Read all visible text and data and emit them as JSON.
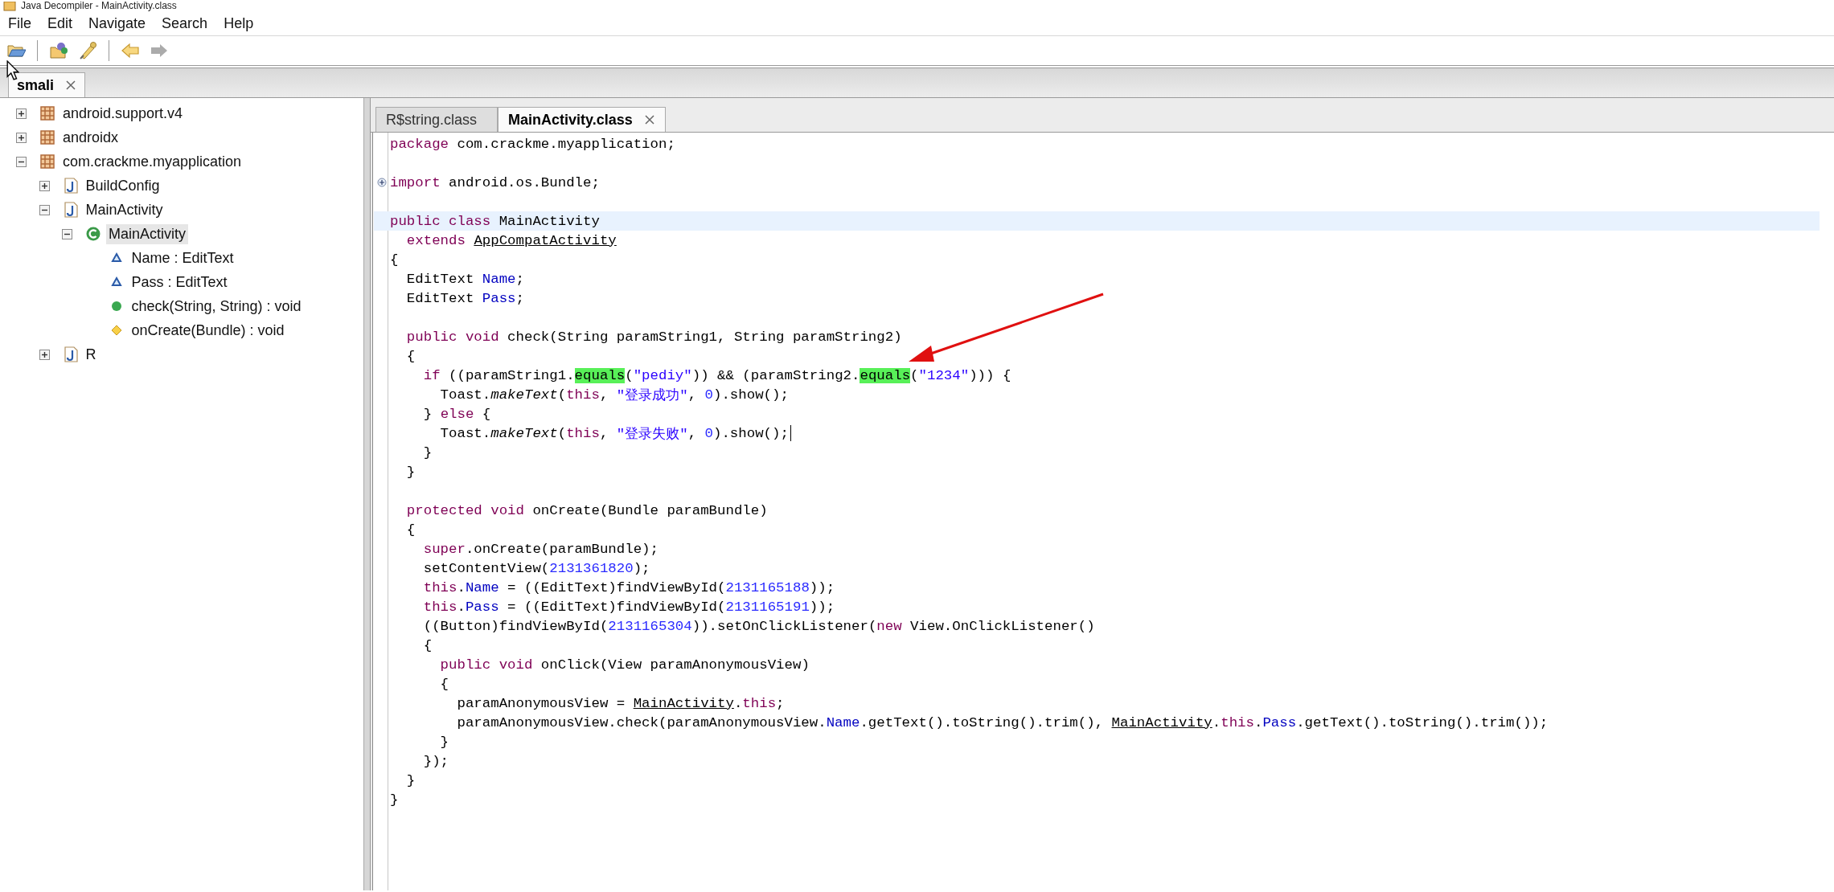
{
  "window": {
    "title": "Java Decompiler - MainActivity.class"
  },
  "menu": [
    "File",
    "Edit",
    "Navigate",
    "Search",
    "Help"
  ],
  "toolbar": [
    {
      "kind": "open",
      "disabled": false
    },
    {
      "kind": "separator"
    },
    {
      "kind": "open_type",
      "disabled": false
    },
    {
      "kind": "search",
      "disabled": false
    },
    {
      "kind": "separator"
    },
    {
      "kind": "back",
      "disabled": false
    },
    {
      "kind": "forward",
      "disabled": true
    }
  ],
  "file_tabs": [
    {
      "label": "smali",
      "selected": true
    }
  ],
  "tree": [
    {
      "label": "android.support.v4",
      "kind": "package",
      "expanded": false,
      "selected": false
    },
    {
      "label": "androidx",
      "kind": "package",
      "expanded": false,
      "selected": false
    },
    {
      "label": "com.crackme.myapplication",
      "kind": "package",
      "expanded": true,
      "selected": false,
      "children": [
        {
          "label": "BuildConfig",
          "kind": "class_file",
          "expanded": false,
          "selected": false
        },
        {
          "label": "MainActivity",
          "kind": "class_file",
          "expanded": true,
          "selected": false,
          "children": [
            {
              "label": "MainActivity",
              "kind": "class",
              "expanded": true,
              "selected": true,
              "children": [
                {
                  "label": "Name : EditText",
                  "kind": "field",
                  "selected": false
                },
                {
                  "label": "Pass : EditText",
                  "kind": "field",
                  "selected": false
                },
                {
                  "label": "check(String, String) : void",
                  "kind": "method_public",
                  "selected": false
                },
                {
                  "label": "onCreate(Bundle) : void",
                  "kind": "method_protected",
                  "selected": false
                }
              ]
            }
          ]
        },
        {
          "label": "R",
          "kind": "class_file",
          "expanded": false,
          "selected": false
        }
      ]
    }
  ],
  "editor_tabs": [
    {
      "label": "R$string.class",
      "selected": false
    },
    {
      "label": "MainActivity.class",
      "selected": true
    }
  ],
  "code": [
    {
      "kind": "code",
      "tokens": [
        {
          "kind": "keyword",
          "text": "package"
        },
        {
          "kind": "text",
          "text": " com.crackme.myapplication;"
        }
      ]
    },
    {
      "kind": "blank"
    },
    {
      "kind": "folded",
      "tokens": [
        {
          "kind": "keyword",
          "text": "import"
        },
        {
          "kind": "text",
          "text": " android.os.Bundle;"
        }
      ]
    },
    {
      "kind": "blank"
    },
    {
      "kind": "current",
      "tokens": [
        {
          "kind": "keyword",
          "text": "public class"
        },
        {
          "kind": "text",
          "text": " MainActivity"
        }
      ]
    },
    {
      "kind": "code",
      "tokens": [
        {
          "kind": "keyword",
          "text": "  extends "
        },
        {
          "kind": "link",
          "text": "AppCompatActivity"
        }
      ]
    },
    {
      "kind": "code",
      "tokens": [
        {
          "kind": "text",
          "text": "{"
        }
      ]
    },
    {
      "kind": "code",
      "tokens": [
        {
          "kind": "text",
          "text": "  EditText "
        },
        {
          "kind": "field",
          "text": "Name"
        },
        {
          "kind": "text",
          "text": ";"
        }
      ]
    },
    {
      "kind": "code",
      "tokens": [
        {
          "kind": "text",
          "text": "  EditText "
        },
        {
          "kind": "field",
          "text": "Pass"
        },
        {
          "kind": "text",
          "text": ";"
        }
      ]
    },
    {
      "kind": "blank"
    },
    {
      "kind": "code",
      "tokens": [
        {
          "kind": "keyword",
          "text": "  public void"
        },
        {
          "kind": "text",
          "text": " check(String paramString1, String paramString2)"
        }
      ]
    },
    {
      "kind": "code",
      "tokens": [
        {
          "kind": "text",
          "text": "  {"
        }
      ]
    },
    {
      "kind": "code",
      "tokens": [
        {
          "kind": "keyword",
          "text": "    if"
        },
        {
          "kind": "text",
          "text": " ((paramString1."
        },
        {
          "kind": "match",
          "text": "equals"
        },
        {
          "kind": "text",
          "text": "("
        },
        {
          "kind": "string",
          "text": "\"pediy\""
        },
        {
          "kind": "text",
          "text": ")) && (paramString2."
        },
        {
          "kind": "match",
          "text": "equals"
        },
        {
          "kind": "text",
          "text": "("
        },
        {
          "kind": "string",
          "text": "\"1234\""
        },
        {
          "kind": "text",
          "text": "))) {"
        }
      ]
    },
    {
      "kind": "code",
      "tokens": [
        {
          "kind": "text",
          "text": "      Toast."
        },
        {
          "kind": "static_call",
          "text": "makeText"
        },
        {
          "kind": "text",
          "text": "("
        },
        {
          "kind": "keyword",
          "text": "this"
        },
        {
          "kind": "text",
          "text": ", "
        },
        {
          "kind": "string",
          "text": "\"登录成功\""
        },
        {
          "kind": "text",
          "text": ", "
        },
        {
          "kind": "number",
          "text": "0"
        },
        {
          "kind": "text",
          "text": ").show();"
        }
      ]
    },
    {
      "kind": "code",
      "tokens": [
        {
          "kind": "text",
          "text": "    } "
        },
        {
          "kind": "keyword",
          "text": "else"
        },
        {
          "kind": "text",
          "text": " {"
        }
      ]
    },
    {
      "kind": "code",
      "tokens": [
        {
          "kind": "text",
          "text": "      Toast."
        },
        {
          "kind": "static_call",
          "text": "makeText"
        },
        {
          "kind": "text",
          "text": "("
        },
        {
          "kind": "keyword",
          "text": "this"
        },
        {
          "kind": "text",
          "text": ", "
        },
        {
          "kind": "string",
          "text": "\"登录失败\""
        },
        {
          "kind": "text",
          "text": ", "
        },
        {
          "kind": "number",
          "text": "0"
        },
        {
          "kind": "text",
          "text": ").show();"
        },
        {
          "kind": "caret"
        }
      ]
    },
    {
      "kind": "code",
      "tokens": [
        {
          "kind": "text",
          "text": "    }"
        }
      ]
    },
    {
      "kind": "code",
      "tokens": [
        {
          "kind": "text",
          "text": "  }"
        }
      ]
    },
    {
      "kind": "blank"
    },
    {
      "kind": "code",
      "tokens": [
        {
          "kind": "keyword",
          "text": "  protected void"
        },
        {
          "kind": "text",
          "text": " onCreate(Bundle paramBundle)"
        }
      ]
    },
    {
      "kind": "code",
      "tokens": [
        {
          "kind": "text",
          "text": "  {"
        }
      ]
    },
    {
      "kind": "code",
      "tokens": [
        {
          "kind": "keyword",
          "text": "    super"
        },
        {
          "kind": "text",
          "text": ".onCreate(paramBundle);"
        }
      ]
    },
    {
      "kind": "code",
      "tokens": [
        {
          "kind": "text",
          "text": "    setContentView("
        },
        {
          "kind": "number",
          "text": "2131361820"
        },
        {
          "kind": "text",
          "text": ");"
        }
      ]
    },
    {
      "kind": "code",
      "tokens": [
        {
          "kind": "keyword",
          "text": "    this"
        },
        {
          "kind": "text",
          "text": "."
        },
        {
          "kind": "field",
          "text": "Name"
        },
        {
          "kind": "text",
          "text": " = ((EditText)findViewById("
        },
        {
          "kind": "number",
          "text": "2131165188"
        },
        {
          "kind": "text",
          "text": "));"
        }
      ]
    },
    {
      "kind": "code",
      "tokens": [
        {
          "kind": "keyword",
          "text": "    this"
        },
        {
          "kind": "text",
          "text": "."
        },
        {
          "kind": "field",
          "text": "Pass"
        },
        {
          "kind": "text",
          "text": " = ((EditText)findViewById("
        },
        {
          "kind": "number",
          "text": "2131165191"
        },
        {
          "kind": "text",
          "text": "));"
        }
      ]
    },
    {
      "kind": "code",
      "tokens": [
        {
          "kind": "text",
          "text": "    ((Button)findViewById("
        },
        {
          "kind": "number",
          "text": "2131165304"
        },
        {
          "kind": "text",
          "text": ")).setOnClickListener("
        },
        {
          "kind": "keyword",
          "text": "new"
        },
        {
          "kind": "text",
          "text": " View.OnClickListener()"
        }
      ]
    },
    {
      "kind": "code",
      "tokens": [
        {
          "kind": "text",
          "text": "    {"
        }
      ]
    },
    {
      "kind": "code",
      "tokens": [
        {
          "kind": "keyword",
          "text": "      public void"
        },
        {
          "kind": "text",
          "text": " onClick(View paramAnonymousView)"
        }
      ]
    },
    {
      "kind": "code",
      "tokens": [
        {
          "kind": "text",
          "text": "      {"
        }
      ]
    },
    {
      "kind": "code",
      "tokens": [
        {
          "kind": "text",
          "text": "        paramAnonymousView = "
        },
        {
          "kind": "link",
          "text": "MainActivity"
        },
        {
          "kind": "text",
          "text": "."
        },
        {
          "kind": "keyword",
          "text": "this"
        },
        {
          "kind": "text",
          "text": ";"
        }
      ]
    },
    {
      "kind": "code",
      "tokens": [
        {
          "kind": "text",
          "text": "        paramAnonymousView.check(paramAnonymousView."
        },
        {
          "kind": "field",
          "text": "Name"
        },
        {
          "kind": "text",
          "text": ".getText().toString().trim(), "
        },
        {
          "kind": "link",
          "text": "MainActivity"
        },
        {
          "kind": "text",
          "text": "."
        },
        {
          "kind": "keyword",
          "text": "this"
        },
        {
          "kind": "text",
          "text": "."
        },
        {
          "kind": "field",
          "text": "Pass"
        },
        {
          "kind": "text",
          "text": ".getText().toString().trim());"
        }
      ]
    },
    {
      "kind": "code",
      "tokens": [
        {
          "kind": "text",
          "text": "      }"
        }
      ]
    },
    {
      "kind": "code",
      "tokens": [
        {
          "kind": "text",
          "text": "    });"
        }
      ]
    },
    {
      "kind": "code",
      "tokens": [
        {
          "kind": "text",
          "text": "  }"
        }
      ]
    },
    {
      "kind": "code",
      "tokens": [
        {
          "kind": "text",
          "text": "}"
        }
      ]
    }
  ]
}
